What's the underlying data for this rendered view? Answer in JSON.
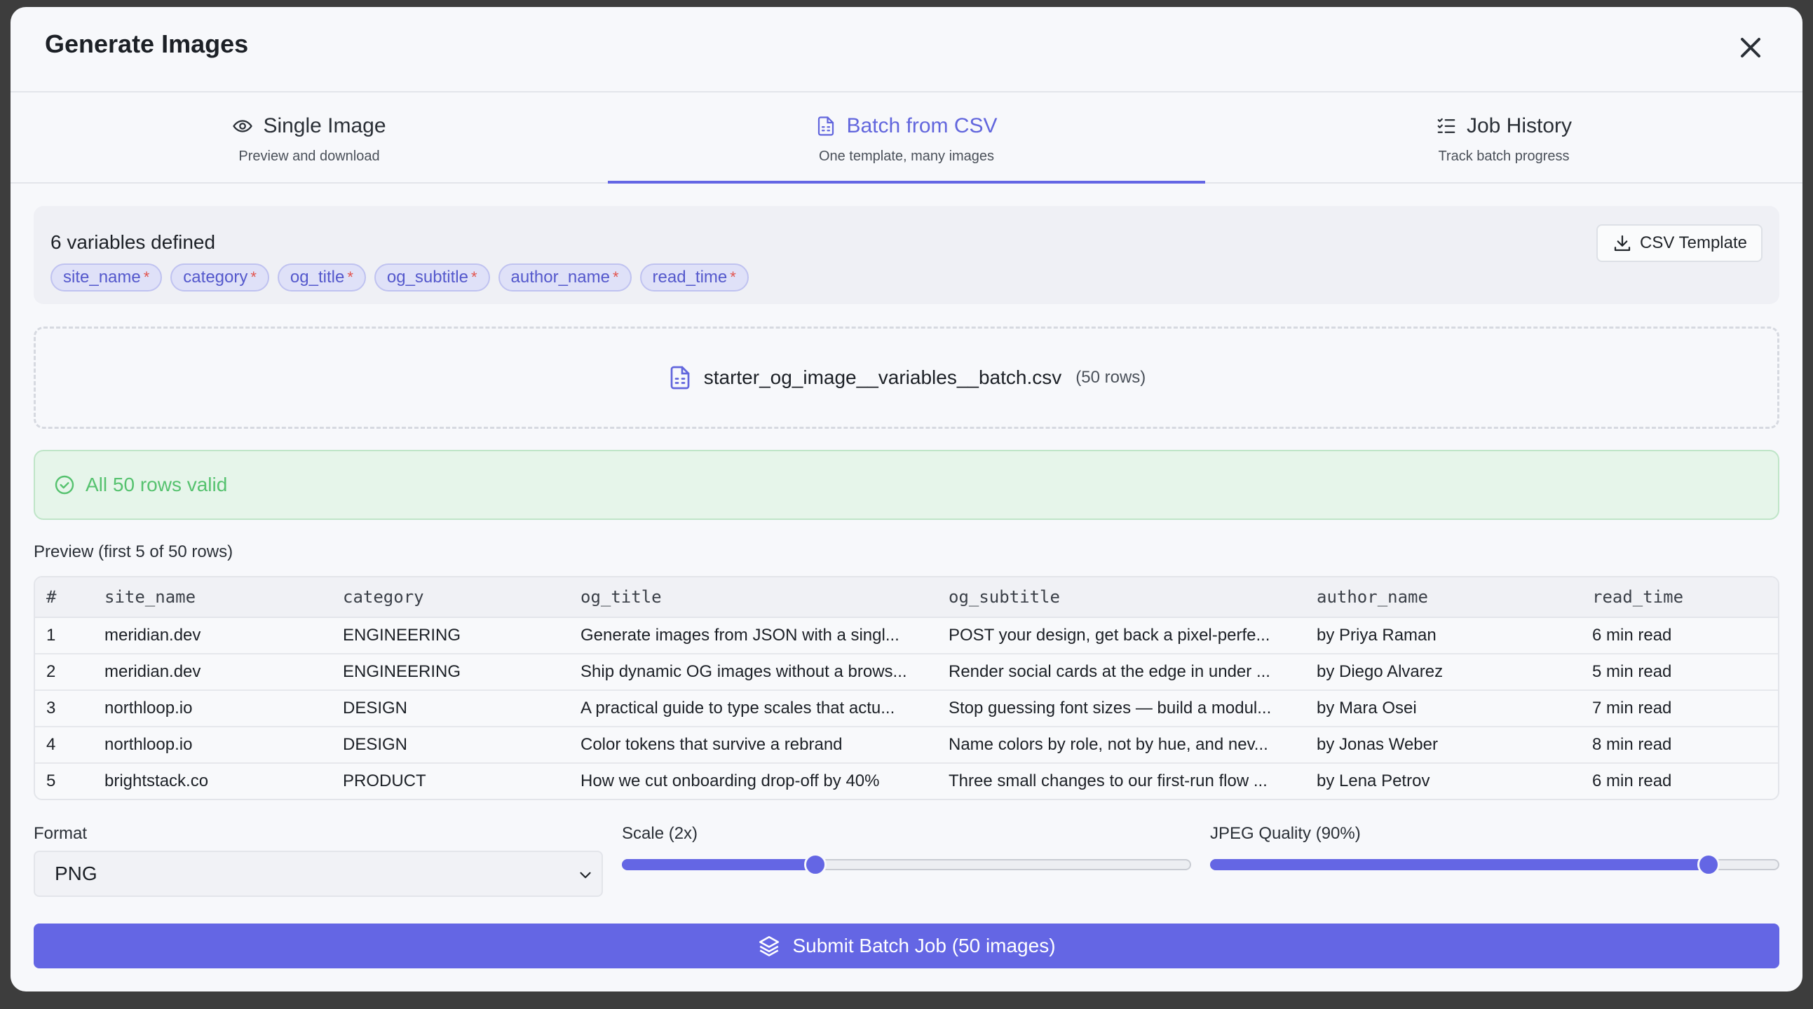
{
  "dialog": {
    "title": "Generate Images"
  },
  "tabs": [
    {
      "label": "Single Image",
      "sub": "Preview and download",
      "icon": "eye-icon"
    },
    {
      "label": "Batch from CSV",
      "sub": "One template, many images",
      "icon": "file-spreadsheet-icon",
      "active": true
    },
    {
      "label": "Job History",
      "sub": "Track batch progress",
      "icon": "list-checks-icon"
    }
  ],
  "variables": {
    "title": "6 variables defined",
    "items": [
      {
        "name": "site_name",
        "required": "*"
      },
      {
        "name": "category",
        "required": "*"
      },
      {
        "name": "og_title",
        "required": "*"
      },
      {
        "name": "og_subtitle",
        "required": "*"
      },
      {
        "name": "author_name",
        "required": "*"
      },
      {
        "name": "read_time",
        "required": "*"
      }
    ],
    "template_button": "CSV Template"
  },
  "upload": {
    "filename": "starter_og_image__variables__batch.csv",
    "rows": "(50 rows)"
  },
  "validation": {
    "message": "All 50 rows valid"
  },
  "preview": {
    "label": "Preview (first 5 of 50 rows)",
    "columns": [
      "#",
      "site_name",
      "category",
      "og_title",
      "og_subtitle",
      "author_name",
      "read_time"
    ],
    "rows": [
      [
        "1",
        "meridian.dev",
        "ENGINEERING",
        "Generate images from JSON with a singl...",
        "POST your design, get back a pixel-perfe...",
        "by Priya Raman",
        "6 min read"
      ],
      [
        "2",
        "meridian.dev",
        "ENGINEERING",
        "Ship dynamic OG images without a brows...",
        "Render social cards at the edge in under ...",
        "by Diego Alvarez",
        "5 min read"
      ],
      [
        "3",
        "northloop.io",
        "DESIGN",
        "A practical guide to type scales that actu...",
        "Stop guessing font sizes — build a modul...",
        "by Mara Osei",
        "7 min read"
      ],
      [
        "4",
        "northloop.io",
        "DESIGN",
        "Color tokens that survive a rebrand",
        "Name colors by role, not by hue, and nev...",
        "by Jonas Weber",
        "8 min read"
      ],
      [
        "5",
        "brightstack.co",
        "PRODUCT",
        "How we cut onboarding drop-off by 40%",
        "Three small changes to our first-run flow ...",
        "by Lena Petrov",
        "6 min read"
      ]
    ]
  },
  "format": {
    "label": "Format",
    "value": "PNG"
  },
  "scale": {
    "label": "Scale (2x)",
    "fraction": 0.34
  },
  "quality": {
    "label": "JPEG Quality (90%)",
    "fraction": 0.875
  },
  "submit": {
    "label": "Submit Batch Job (50 images)"
  },
  "colors": {
    "accent": "#6466e4",
    "success": "#56c26f",
    "required": "#e2554f"
  }
}
